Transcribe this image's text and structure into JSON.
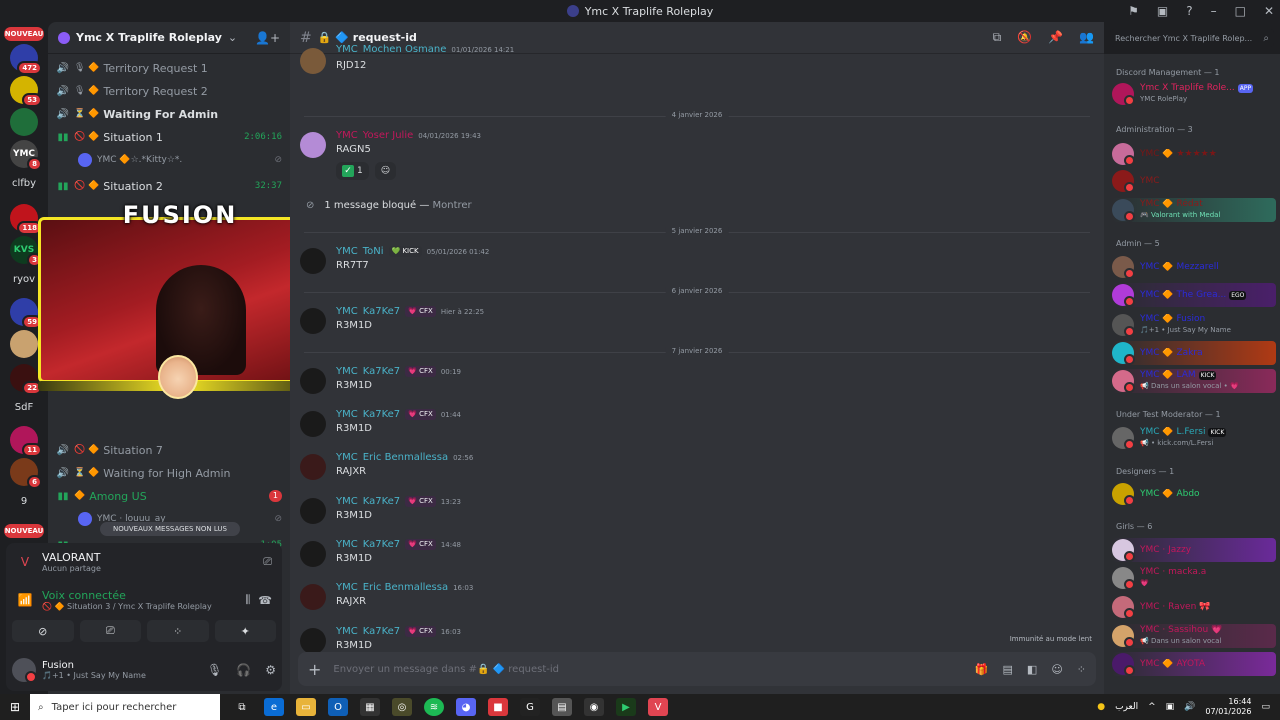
{
  "window": {
    "title": "Ymc X Traplife Roleplay"
  },
  "rail": {
    "new_label": "NOUVEAU",
    "servers": [
      {
        "label": "",
        "badge": "472"
      },
      {
        "label": "",
        "badge": "53"
      },
      {
        "label": "",
        "badge": ""
      },
      {
        "label": "YMC",
        "badge": "8"
      },
      {
        "label": "clfby",
        "badge": ""
      },
      {
        "label": "",
        "badge": "118"
      },
      {
        "label": "KVS",
        "badge": "3"
      },
      {
        "label": "ryov",
        "badge": "1"
      },
      {
        "label": "",
        "badge": "59"
      },
      {
        "label": "",
        "badge": ""
      },
      {
        "label": "",
        "badge": "22"
      },
      {
        "label": "SdF",
        "badge": ""
      },
      {
        "label": "",
        "badge": "11"
      },
      {
        "label": "",
        "badge": "6"
      },
      {
        "label": "9",
        "badge": ""
      }
    ],
    "new_label_bottom": "NOUVEAU"
  },
  "guild": {
    "name": "Ymc X Traplife Roleplay"
  },
  "channels": [
    {
      "name": "Territory Request 1",
      "mark": "🎙 🔶",
      "time": "",
      "active": false
    },
    {
      "name": "Territory Request 2",
      "mark": "🎙 🔶",
      "time": "",
      "active": false
    },
    {
      "name": "Waiting For Admin",
      "mark": "⏳ 🔶",
      "time": "",
      "active": false
    },
    {
      "name": "Situation 1",
      "mark": "🚫 🔶",
      "time": "2:06:16",
      "active": true
    },
    {
      "name": "Situation 2",
      "mark": "🚫 🔶",
      "time": "32:37",
      "active": true
    },
    {
      "name": "Situation 7",
      "mark": "🚫 🔶",
      "time": "",
      "active": false
    },
    {
      "name": "Waiting for High Admin",
      "mark": "⏳ 🔶",
      "time": "",
      "active": false
    },
    {
      "name": "Among US",
      "mark": "🔶",
      "time": "",
      "active": true,
      "badge": "1"
    }
  ],
  "channel_members": {
    "situation1": {
      "name": "YMC 🔶☆.*Kitty☆*."
    },
    "among_us": {
      "name": "YMC · louuu_ay"
    },
    "bottom_time": "1:05"
  },
  "overlay": {
    "title": "FUSION"
  },
  "new_messages_pill": "NOUVEAUX MESSAGES NON LUS",
  "panel": {
    "game_title": "VALORANT",
    "game_sub": "Aucun partage",
    "voice_title": "Voix connectée",
    "voice_sub": "🚫 🔶 Situation 3 / Ymc X Traplife Roleplay",
    "user_name": "Fusion",
    "user_status": "🎵+1 • Just Say My Name"
  },
  "chat": {
    "channel": "🔒 🔷 request-id",
    "search_placeholder": "Rechercher Ymc X Traplife Rolep...",
    "composer_placeholder": "Envoyer un message dans #🔒 🔷 request-id",
    "immunity": "Immunité au mode lent",
    "blocked": "1 message bloqué —",
    "blocked_link": "Montrer",
    "dates": [
      "4 janvier 2026",
      "5 janvier 2026",
      "6 janvier 2026",
      "7 janvier 2026"
    ],
    "reaction_count": "1",
    "messages": [
      {
        "tag": "YMC",
        "user": "Mochen Osmane",
        "badge": "",
        "time": "01/01/2026 14:21",
        "text": "RJD12"
      },
      {
        "tag": "YMC",
        "user": "Yoser Julie",
        "badge": "",
        "time": "04/01/2026 19:43",
        "text": "RAGN5"
      },
      {
        "tag": "YMC",
        "user": "ToNi",
        "badge": "💚 KICK",
        "time": "05/01/2026 01:42",
        "text": "RR7T7"
      },
      {
        "tag": "YMC",
        "user": "Ka7Ke7",
        "badge": "💗 CFX",
        "time": "Hier à 22:25",
        "text": "R3M1D"
      },
      {
        "tag": "YMC",
        "user": "Ka7Ke7",
        "badge": "💗 CFX",
        "time": "00:19",
        "text": "R3M1D"
      },
      {
        "tag": "YMC",
        "user": "Ka7Ke7",
        "badge": "💗 CFX",
        "time": "01:44",
        "text": "R3M1D"
      },
      {
        "tag": "YMC",
        "user": "Eric Benmallessa",
        "badge": "",
        "time": "02:56",
        "text": "RAJXR"
      },
      {
        "tag": "YMC",
        "user": "Ka7Ke7",
        "badge": "💗 CFX",
        "time": "13:23",
        "text": "R3M1D"
      },
      {
        "tag": "YMC",
        "user": "Ka7Ke7",
        "badge": "💗 CFX",
        "time": "14:48",
        "text": "R3M1D"
      },
      {
        "tag": "YMC",
        "user": "Eric Benmallessa",
        "badge": "",
        "time": "16:03",
        "text": "RAJXR"
      },
      {
        "tag": "YMC",
        "user": "Ka7Ke7",
        "badge": "💗 CFX",
        "time": "16:03",
        "text": "R3M1D"
      }
    ]
  },
  "members": {
    "groups": [
      {
        "label": "Discord Management — 1"
      },
      {
        "label": "Administration — 3"
      },
      {
        "label": "Admin — 5"
      },
      {
        "label": "Under Test Moderator — 1"
      },
      {
        "label": "Designers — 1"
      },
      {
        "label": "Girls — 6"
      }
    ],
    "list": [
      {
        "name": "Ymc X Traplife Role...",
        "status": "YMC RolePlay",
        "color": "#e0245e",
        "tag": "APP"
      },
      {
        "name": "YMC 🔶 ★★★★★",
        "status": "",
        "color": "#7a1616",
        "tag": ""
      },
      {
        "name": "YMC",
        "status": "",
        "color": "#8b1a1a",
        "tag": ""
      },
      {
        "name": "YMC 🔶 Rédat",
        "status": "🎮 Valorant with Medal",
        "color": "#8b1a1a",
        "tag": ""
      },
      {
        "name": "YMC 🔶 Mezzarell",
        "status": "",
        "color": "#2b2bd9",
        "tag": ""
      },
      {
        "name": "YMC 🔶 The Grea...",
        "status": "",
        "color": "#2b2bd9",
        "tag": "EGO"
      },
      {
        "name": "YMC 🔶 Fusion",
        "status": "🎵+1 • Just Say My Name",
        "color": "#2b2bd9",
        "tag": ""
      },
      {
        "name": "YMC 🔶 Zakra",
        "status": "",
        "color": "#2b2bd9",
        "tag": ""
      },
      {
        "name": "YMC 🔶 LAM",
        "status": "📢 Dans un salon vocal • 💗",
        "color": "#2b2bd9",
        "tag": "KICK"
      },
      {
        "name": "YMC 🔶 L.Fersi",
        "status": "📢 • kick.com/L.Fersi",
        "color": "#2aa9b8",
        "tag": "KICK"
      },
      {
        "name": "YMC 🔶 Abdo",
        "status": "",
        "color": "#2ecc71",
        "tag": ""
      },
      {
        "name": "YMC · Jazzy",
        "status": "",
        "color": "#c2185b",
        "tag": ""
      },
      {
        "name": "YMC · macka.a",
        "status": "💗",
        "color": "#c2185b",
        "tag": ""
      },
      {
        "name": "YMC · Raven 🎀",
        "status": "",
        "color": "#c2185b",
        "tag": ""
      },
      {
        "name": "YMC · Sassihou 💗",
        "status": "📢 Dans un salon vocal",
        "color": "#c2185b",
        "tag": ""
      },
      {
        "name": "YMC 🔶 AYOTA",
        "status": "",
        "color": "#c2185b",
        "tag": ""
      }
    ]
  },
  "taskbar": {
    "search_placeholder": "Taper ici pour rechercher",
    "lang": "العرب",
    "time": "16:44",
    "date": "07/01/2026"
  }
}
